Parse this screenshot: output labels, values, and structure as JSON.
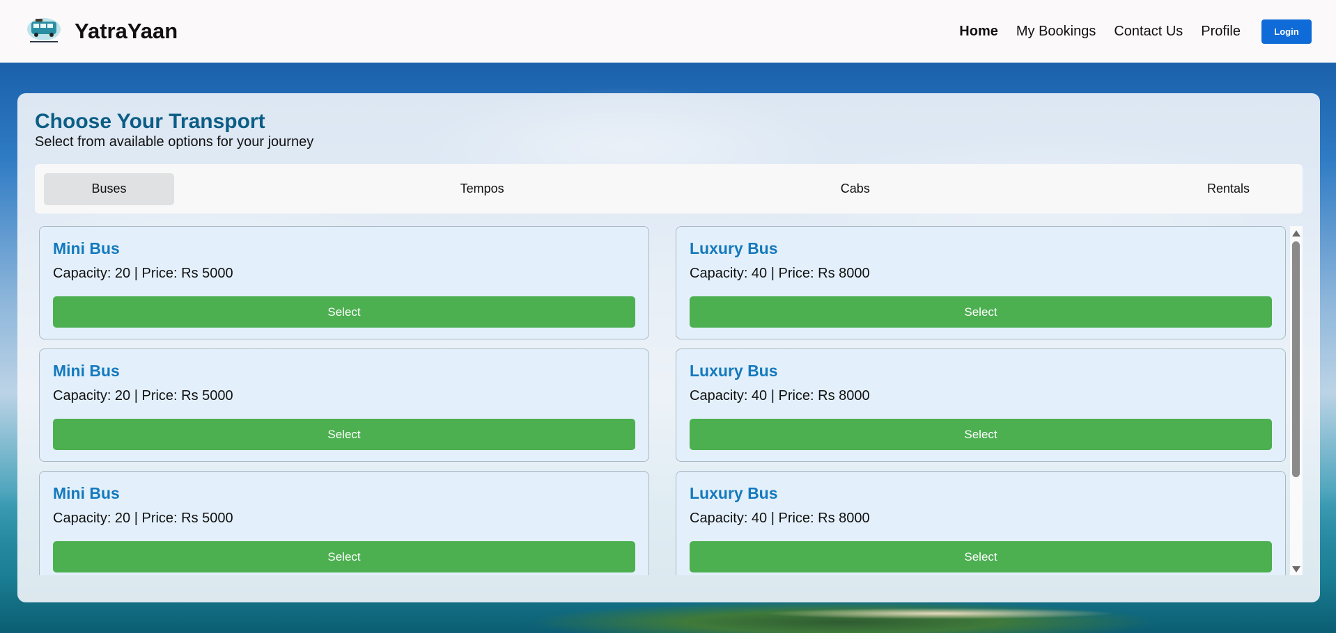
{
  "brand": {
    "name": "YatraYaan",
    "logo_text": "YATRA YAAN"
  },
  "nav": {
    "links": [
      "Home",
      "My Bookings",
      "Contact Us",
      "Profile"
    ],
    "login_label": "Login"
  },
  "page": {
    "title": "Choose Your Transport",
    "subtitle": "Select from available options for your journey"
  },
  "tabs": [
    "Buses",
    "Tempos",
    "Cabs",
    "Rentals"
  ],
  "active_tab": "Buses",
  "cards": [
    {
      "title": "Mini Bus",
      "info": "Capacity: 20 | Price: Rs 5000",
      "button": "Select"
    },
    {
      "title": "Luxury Bus",
      "info": "Capacity: 40 | Price: Rs 8000",
      "button": "Select"
    },
    {
      "title": "Mini Bus",
      "info": "Capacity: 20 | Price: Rs 5000",
      "button": "Select"
    },
    {
      "title": "Luxury Bus",
      "info": "Capacity: 40 | Price: Rs 8000",
      "button": "Select"
    },
    {
      "title": "Mini Bus",
      "info": "Capacity: 20 | Price: Rs 5000",
      "button": "Select"
    },
    {
      "title": "Luxury Bus",
      "info": "Capacity: 40 | Price: Rs 8000",
      "button": "Select"
    }
  ],
  "colors": {
    "accent": "#0f6bd7",
    "title": "#0c5d86",
    "card_title": "#1479bd",
    "select_button": "#4caf50",
    "card_bg": "#e3f0fb"
  },
  "icons": [
    "bus-logo-icon",
    "scroll-up-arrow-icon",
    "scroll-down-arrow-icon"
  ]
}
